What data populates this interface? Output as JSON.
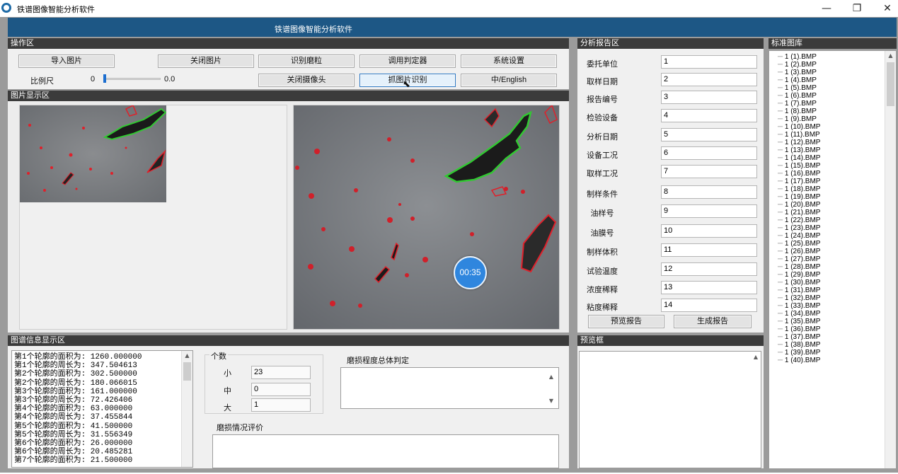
{
  "window": {
    "title": "铁谱图像智能分析软件",
    "controls": {
      "minimize": "—",
      "maximize": "❐",
      "close": "✕"
    }
  },
  "banner": {
    "title": "铁谱图像智能分析软件"
  },
  "operation": {
    "header": "操作区",
    "buttons": {
      "import": "导入图片",
      "close_image": "关闭图片",
      "identify_particles": "识别磨粒",
      "call_classifier": "调用判定器",
      "settings": "系统设置",
      "close_camera": "关闭摄像头",
      "capture_identify": "抓图片识别",
      "language": "中/English"
    },
    "scale_label": "比例尺",
    "scale_min": "0",
    "scale_value": "0.0",
    "scale_fraction": 0.0
  },
  "image_display": {
    "header": "图片显示区"
  },
  "timer": {
    "value": "00:35"
  },
  "info": {
    "header": "图谱信息显示区",
    "lines": [
      "第1个轮廓的面积为: 1260.000000",
      "第1个轮廓的周长为: 347.504613",
      "第2个轮廓的面积为: 302.500000",
      "第2个轮廓的周长为: 180.066015",
      "第3个轮廓的面积为: 161.000000",
      "第3个轮廓的周长为: 72.426406",
      "第4个轮廓的面积为: 63.000000",
      "第4个轮廓的周长为: 37.455844",
      "第5个轮廓的面积为: 41.500000",
      "第5个轮廓的周长为: 31.556349",
      "第6个轮廓的面积为: 26.000000",
      "第6个轮廓的周长为: 20.485281",
      "第7个轮廓的面积为: 21.500000"
    ]
  },
  "counts": {
    "group_label": "个数",
    "small_label": "小",
    "small_value": "23",
    "medium_label": "中",
    "medium_value": "0",
    "large_label": "大",
    "large_value": "1"
  },
  "wear_overall": {
    "label": "磨损程度总体判定",
    "value": ""
  },
  "wear_eval": {
    "label": "磨损情况评价",
    "value": ""
  },
  "report": {
    "header": "分析报告区",
    "fields": [
      {
        "label": "委托单位",
        "value": "1"
      },
      {
        "label": "取样日期",
        "value": "2"
      },
      {
        "label": "报告编号",
        "value": "3"
      },
      {
        "label": "检验设备",
        "value": "4"
      },
      {
        "label": "分析日期",
        "value": "5"
      },
      {
        "label": "设备工况",
        "value": "6"
      },
      {
        "label": "取样工况",
        "value": "7"
      },
      {
        "label": "制样条件",
        "value": "8"
      },
      {
        "label": "油样号",
        "value": "9"
      },
      {
        "label": "油膜号",
        "value": "10"
      },
      {
        "label": "制样体积",
        "value": "11"
      },
      {
        "label": "试验温度",
        "value": "12"
      },
      {
        "label": "浓度稀释",
        "value": "13"
      },
      {
        "label": "粘度稀释",
        "value": "14"
      }
    ],
    "preview_button": "预览报告",
    "generate_button": "生成报告"
  },
  "preview": {
    "header": "预览框"
  },
  "library": {
    "header": "标准图库",
    "items": [
      "1 (1).BMP",
      "1 (2).BMP",
      "1 (3).BMP",
      "1 (4).BMP",
      "1 (5).BMP",
      "1 (6).BMP",
      "1 (7).BMP",
      "1 (8).BMP",
      "1 (9).BMP",
      "1 (10).BMP",
      "1 (11).BMP",
      "1 (12).BMP",
      "1 (13).BMP",
      "1 (14).BMP",
      "1 (15).BMP",
      "1 (16).BMP",
      "1 (17).BMP",
      "1 (18).BMP",
      "1 (19).BMP",
      "1 (20).BMP",
      "1 (21).BMP",
      "1 (22).BMP",
      "1 (23).BMP",
      "1 (24).BMP",
      "1 (25).BMP",
      "1 (26).BMP",
      "1 (27).BMP",
      "1 (28).BMP",
      "1 (29).BMP",
      "1 (30).BMP",
      "1 (31).BMP",
      "1 (32).BMP",
      "1 (33).BMP",
      "1 (34).BMP",
      "1 (35).BMP",
      "1 (36).BMP",
      "1 (37).BMP",
      "1 (38).BMP",
      "1 (39).BMP",
      "1 (40).BMP"
    ]
  },
  "colors": {
    "banner": "#1d5785",
    "header_dark": "#3b3b3b",
    "contour_red": "#e0202a",
    "contour_green": "#32c832",
    "timer": "#2f86de"
  }
}
